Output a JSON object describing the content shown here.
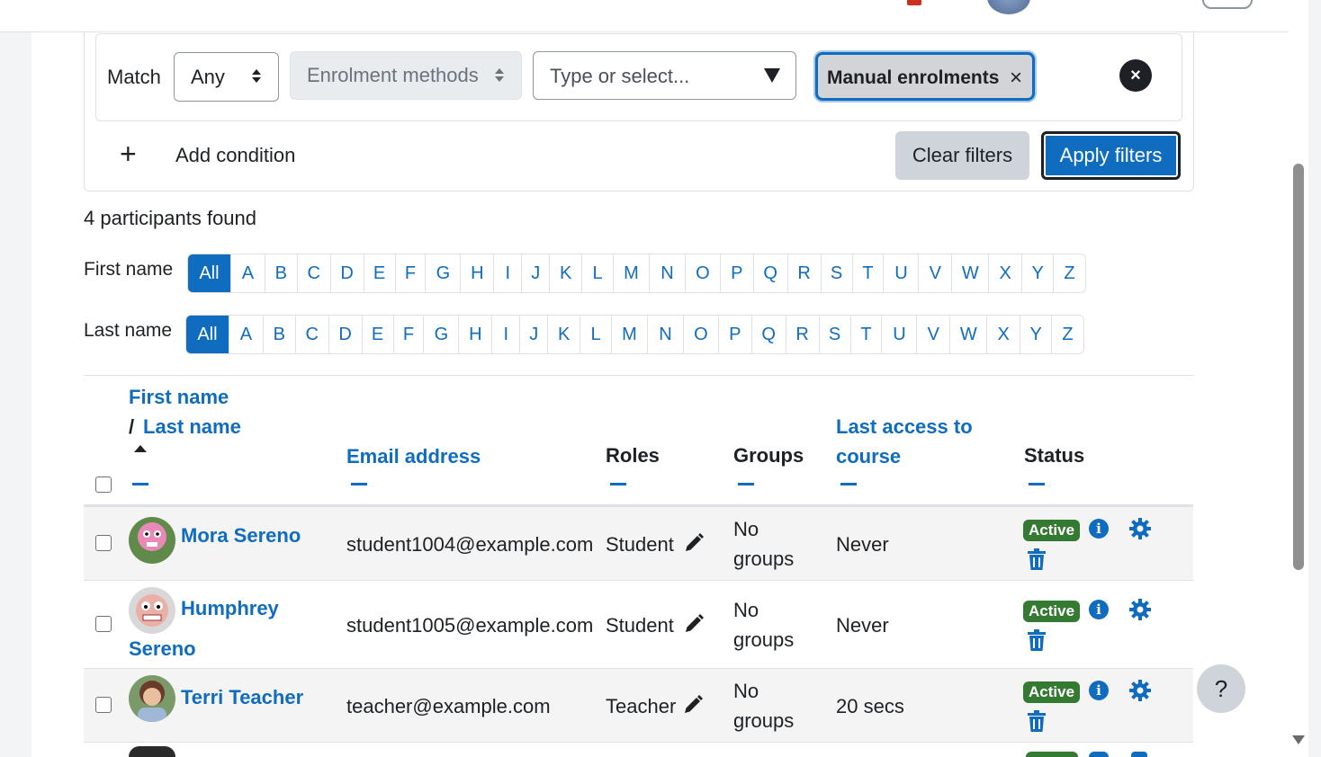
{
  "filters": {
    "match_label": "Match",
    "match_value": "Any",
    "type_value": "Enrolment methods",
    "search_placeholder": "Type or select...",
    "selected_tag": "Manual enrolments",
    "tag_remove": "×",
    "remove_condition": "×",
    "add_condition_icon": "+",
    "add_condition": "Add condition",
    "clear": "Clear filters",
    "apply": "Apply filters"
  },
  "results_count": "4 participants found",
  "initials": {
    "first_label": "First name",
    "last_label": "Last name",
    "letters": [
      "All",
      "A",
      "B",
      "C",
      "D",
      "E",
      "F",
      "G",
      "H",
      "I",
      "J",
      "K",
      "L",
      "M",
      "N",
      "O",
      "P",
      "Q",
      "R",
      "S",
      "T",
      "U",
      "V",
      "W",
      "X",
      "Y",
      "Z"
    ]
  },
  "table": {
    "headers": {
      "first_name": "First name",
      "slash": "/",
      "last_name": "Last name",
      "email": "Email address",
      "roles": "Roles",
      "groups": "Groups",
      "last_access_1": "Last access to",
      "last_access_2": "course",
      "status": "Status"
    },
    "rows": [
      {
        "name": "Mora Sereno",
        "email": "student1004@example.com",
        "role": "Student",
        "groups_1": "No",
        "groups_2": "groups",
        "last_access": "Never",
        "status": "Active"
      },
      {
        "name_1": "Humphrey",
        "name_2": "Sereno",
        "email": "student1005@example.com",
        "role": "Student",
        "groups_1": "No",
        "groups_2": "groups",
        "last_access": "Never",
        "status": "Active"
      },
      {
        "name": "Terri Teacher",
        "email": "teacher@example.com",
        "role": "Teacher",
        "groups_1": "No",
        "groups_2": "groups",
        "last_access": "20 secs",
        "status": "Active"
      }
    ],
    "info_glyph": "i"
  },
  "help": "?",
  "colors": {
    "primary": "#0f6cbf",
    "active_badge": "#357a32",
    "secondary": "#ced4da"
  },
  "icons": [
    "updown-icon",
    "dropdown-triangle-icon",
    "close-icon",
    "plus-icon",
    "sort-asc-icon",
    "pencil-icon",
    "info-icon",
    "gear-icon",
    "trash-icon",
    "help-icon"
  ]
}
